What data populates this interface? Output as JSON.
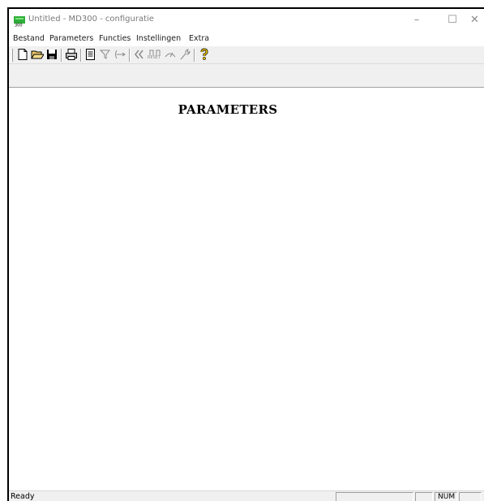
{
  "window": {
    "title": "Untitled - MD300 - configuratie",
    "minimize_glyph": "–",
    "maximize_glyph": "☐",
    "close_glyph": "✕"
  },
  "menu": {
    "items": [
      "Bestand",
      "Parameters",
      "Functies",
      "Instellingen",
      "Extra"
    ]
  },
  "toolbar": {
    "buttons": [
      "new-document-icon",
      "open-folder-icon",
      "save-icon",
      "print-icon",
      "preview-icon",
      "filter-icon",
      "connect-icon",
      "disconnect-icon",
      "reset-icon",
      "tune-icon",
      "wrench-icon",
      "help-icon"
    ],
    "reset_caption": "RESET"
  },
  "document": {
    "heading": "PARAMETERS"
  },
  "status": {
    "text": "Ready",
    "num_indicator": "NUM"
  },
  "colors": {
    "app_icon": "#2fae3a",
    "help_icon": "#e8c000"
  }
}
